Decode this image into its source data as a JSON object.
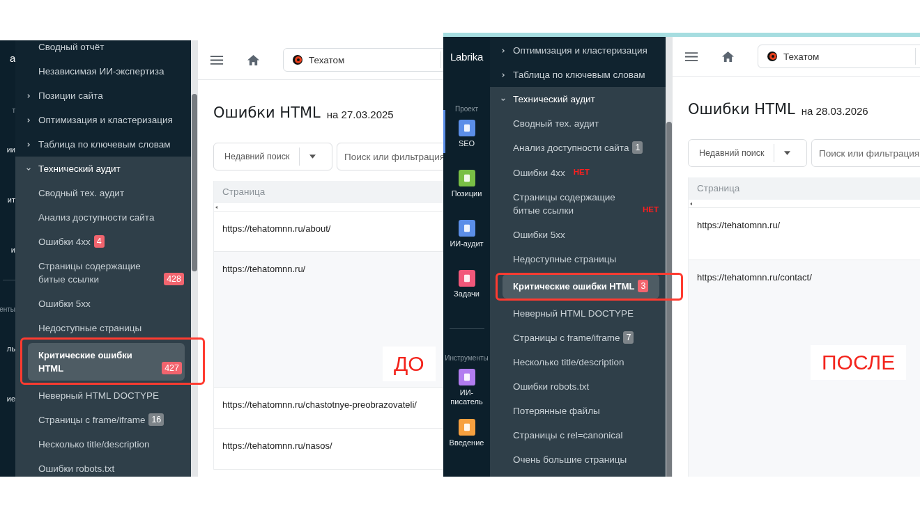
{
  "panels": [
    {
      "caption": "ДО",
      "rail": [
        {
          "kind": "logo",
          "label": "а"
        },
        {
          "kind": "section",
          "label": "т"
        },
        {
          "kind": "app",
          "label": "ии",
          "selected": false
        },
        {
          "kind": "app",
          "label": "ит",
          "selected": false
        },
        {
          "kind": "app",
          "label": "и",
          "selected": false
        },
        {
          "kind": "divider"
        },
        {
          "kind": "section",
          "label": "енты"
        },
        {
          "kind": "app",
          "label": "ль",
          "selected": false
        },
        {
          "kind": "app",
          "label": "ие",
          "selected": false
        }
      ],
      "menu": [
        {
          "kind": "link",
          "label": "Сводный отчёт"
        },
        {
          "kind": "link",
          "label": "Независимая ИИ-экспертиза"
        },
        {
          "kind": "group",
          "label": "Позиции сайта",
          "expanded": false
        },
        {
          "kind": "group",
          "label": "Оптимизация и кластеризация",
          "expanded": false
        },
        {
          "kind": "group",
          "label": "Таблица по ключевым словам",
          "expanded": false
        },
        {
          "kind": "group",
          "label": "Технический аудит",
          "expanded": true,
          "children": [
            {
              "label": "Сводный тех. аудит",
              "selected": false,
              "highlighted": false
            },
            {
              "label": "Анализ доступности сайта",
              "selected": false,
              "highlighted": false
            },
            {
              "label": "Ошибки 4xx",
              "badge": {
                "text": "4",
                "color": "#f1646e"
              },
              "selected": false,
              "highlighted": false
            },
            {
              "label": "Страницы содержащие битые ссылки",
              "badge": {
                "text": "428",
                "color": "#f1646e"
              },
              "selected": false,
              "highlighted": false
            },
            {
              "label": "Ошибки 5xx",
              "selected": false,
              "highlighted": false
            },
            {
              "label": "Недоступные страницы",
              "selected": false,
              "highlighted": false
            },
            {
              "label": "Критические ошибки HTML",
              "badge": {
                "text": "427",
                "color": "#f1646e"
              },
              "selected": true,
              "highlighted": true
            },
            {
              "label": "Неверный HTML DOCTYPE",
              "selected": false,
              "highlighted": false
            },
            {
              "label": "Страницы с frame/iframe",
              "badge": {
                "text": "16",
                "color": "#7d8489"
              },
              "selected": false,
              "highlighted": false
            },
            {
              "label": "Несколько title/description",
              "selected": false,
              "highlighted": false
            },
            {
              "label": "Ошибки robots.txt",
              "selected": false,
              "highlighted": false
            }
          ]
        }
      ],
      "project": "Техатом",
      "title": "Ошибки HTML",
      "date": "на 27.03.2025",
      "recent_search": "Недавний поиск",
      "search_placeholder": "Поиск или фильтрация",
      "column": "Страница",
      "rows": [
        "https://tehatomnn.ru/about/",
        "https://tehatomnn.ru/",
        "https://tehatomnn.ru/chastotnye-preobrazovateli/",
        "https://tehatomnn.ru/nasos/"
      ]
    },
    {
      "caption": "ПОСЛЕ",
      "rail": [
        {
          "kind": "logo",
          "label": "Labrika"
        },
        {
          "kind": "section",
          "label": "Проект"
        },
        {
          "kind": "app",
          "label": "SEO",
          "color": "#5b8ee8",
          "selected": true
        },
        {
          "kind": "app",
          "label": "Позиции",
          "color": "#79bf45",
          "selected": false
        },
        {
          "kind": "app",
          "label": "ИИ-аудит",
          "color": "#5b8ee8",
          "selected": false
        },
        {
          "kind": "app",
          "label": "Задачи",
          "color": "#f2577a",
          "selected": false
        },
        {
          "kind": "divider"
        },
        {
          "kind": "section",
          "label": "Инструменты"
        },
        {
          "kind": "app",
          "label": "ИИ-писатель",
          "color": "#b27cf0",
          "selected": false
        },
        {
          "kind": "app",
          "label": "Введение",
          "color": "#f7a03f",
          "selected": false
        }
      ],
      "menu": [
        {
          "kind": "group",
          "label": "Оптимизация и кластеризация",
          "expanded": false
        },
        {
          "kind": "group",
          "label": "Таблица по ключевым словам",
          "expanded": false
        },
        {
          "kind": "group",
          "label": "Технический аудит",
          "expanded": true,
          "children": [
            {
              "label": "Сводный тех. аудит",
              "selected": false,
              "highlighted": false
            },
            {
              "label": "Анализ доступности сайта",
              "badge": {
                "text": "1",
                "color": "#7d8489"
              },
              "selected": false,
              "highlighted": false
            },
            {
              "label": "Ошибки 4xx",
              "note": "НЕТ",
              "selected": false,
              "highlighted": false
            },
            {
              "label": "Страницы содержащие битые ссылки",
              "note": "НЕТ",
              "selected": false,
              "highlighted": false
            },
            {
              "label": "Ошибки 5xx",
              "selected": false,
              "highlighted": false
            },
            {
              "label": "Недоступные страницы",
              "selected": false,
              "highlighted": false
            },
            {
              "label": "Критические ошибки HTML",
              "badge": {
                "text": "3",
                "color": "#f1646e"
              },
              "selected": true,
              "highlighted": true
            },
            {
              "label": "Неверный HTML DOCTYPE",
              "selected": false,
              "highlighted": false
            },
            {
              "label": "Страницы с frame/iframe",
              "badge": {
                "text": "7",
                "color": "#7d8489"
              },
              "selected": false,
              "highlighted": false
            },
            {
              "label": "Несколько title/description",
              "selected": false,
              "highlighted": false
            },
            {
              "label": "Ошибки robots.txt",
              "selected": false,
              "highlighted": false
            },
            {
              "label": "Потерянные файлы",
              "selected": false,
              "highlighted": false
            },
            {
              "label": "Страницы с rel=canonical",
              "selected": false,
              "highlighted": false
            },
            {
              "label": "Очень большие страницы",
              "selected": false,
              "highlighted": false
            }
          ]
        }
      ],
      "project": "Техатом",
      "title": "Ошибки HTML",
      "date": "на 28.03.2026",
      "recent_search": "Недавний поиск",
      "search_placeholder": "Поиск или фильтрация",
      "column": "Страница",
      "rows": [
        "https://tehatomnn.ru/",
        "https://tehatomnn.ru/contact/"
      ]
    }
  ]
}
